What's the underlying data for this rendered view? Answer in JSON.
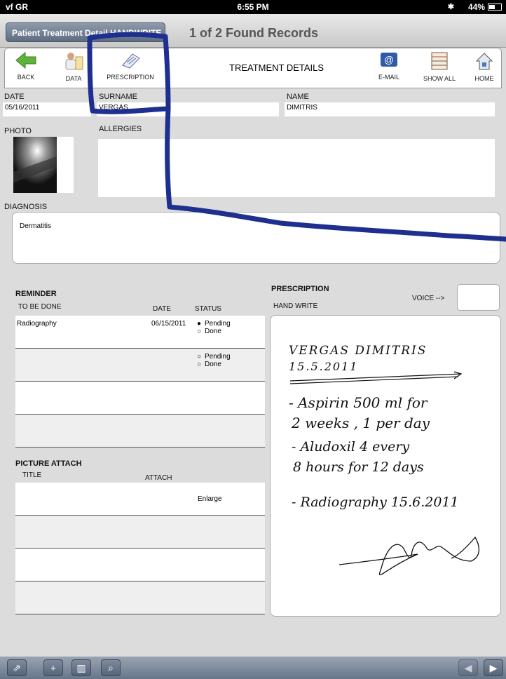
{
  "status_bar": {
    "carrier": "vf GR",
    "time": "6:55 PM",
    "battery": "44%"
  },
  "title_bar": {
    "layout_label": "Patient Treatment Detail HANDWRITE",
    "records": "1 of 2 Found Records"
  },
  "toolbar": {
    "back": "BACK",
    "data": "DATA",
    "prescription": "PRESCRIPTION",
    "title": "TREATMENT DETAILS",
    "email": "E-MAIL",
    "show_all": "SHOW ALL",
    "home": "HOME"
  },
  "form": {
    "date_label": "DATE",
    "date_value": "05/16/2011",
    "surname_label": "SURNAME",
    "surname_value": "VERGAS",
    "name_label": "NAME",
    "name_value": "DIMITRIS",
    "photo_label": "PHOTO",
    "allergies_label": "ALLERGIES",
    "allergies_value": "",
    "diagnosis_label": "DIAGNOSIS",
    "diagnosis_value": "Dermatitis"
  },
  "reminder": {
    "title": "REMINDER",
    "col_todo": "TO BE DONE",
    "col_date": "DATE",
    "col_status": "STATUS",
    "rows": [
      {
        "todo": "Radiography",
        "date": "06/15/2011",
        "pending": "Pending",
        "done": "Done",
        "selected": "pending"
      },
      {
        "todo": "",
        "date": "",
        "pending": "Pending",
        "done": "Done",
        "selected": ""
      },
      {
        "todo": "",
        "date": "",
        "pending": "",
        "done": "",
        "selected": ""
      },
      {
        "todo": "",
        "date": "",
        "pending": "",
        "done": "",
        "selected": ""
      }
    ]
  },
  "picture_attach": {
    "title": "PICTURE ATTACH",
    "col_title": "TITLE",
    "col_attach": "ATTACH",
    "rows": [
      {
        "title": "",
        "attach": "Enlarge"
      },
      {
        "title": "",
        "attach": ""
      },
      {
        "title": "",
        "attach": ""
      },
      {
        "title": "",
        "attach": ""
      }
    ]
  },
  "prescription": {
    "title": "PRESCRIPTION",
    "hand_write_label": "HAND WRITE",
    "voice_label": "VOICE -->",
    "handwritten_lines": [
      "VERGAS DIMITRIS",
      "15.5.2011",
      "- Aspirin 500 ml for",
      "2 weeks , 1 per day",
      "- Aludoxil 4 every",
      "8 hours for 12 days",
      "- Radiography 15.6.2011"
    ]
  },
  "colors": {
    "annotation_ink": "#1f2f8f",
    "title_button": "#6d7a90"
  }
}
